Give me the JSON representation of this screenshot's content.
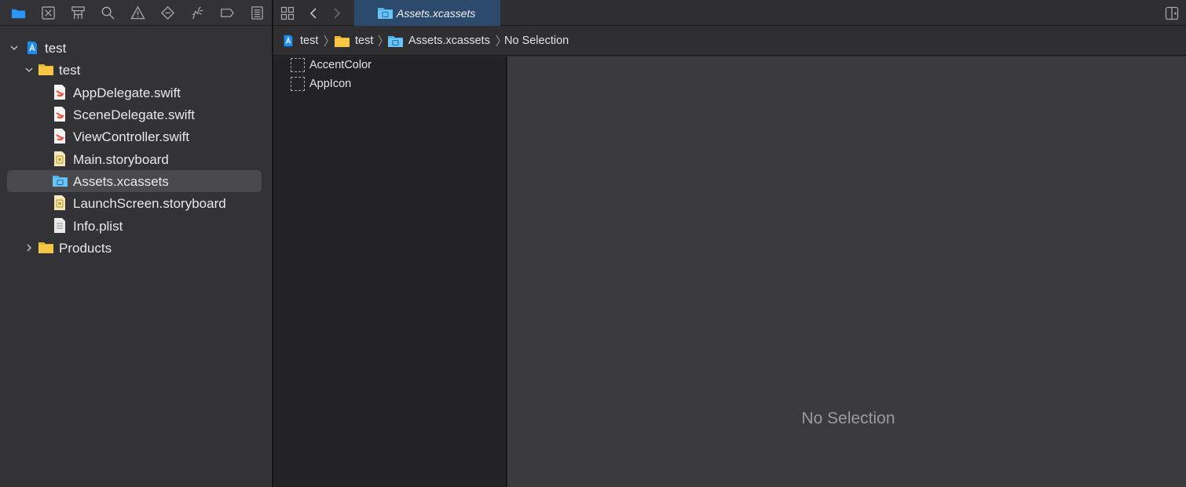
{
  "navigator": {
    "toolbar_icons": [
      "folder-icon",
      "source-control-icon",
      "symbol-icon",
      "find-icon",
      "issue-icon",
      "test-icon",
      "debug-icon",
      "breakpoint-icon",
      "report-icon"
    ],
    "tree": [
      {
        "label": "test",
        "icon": "project-icon",
        "expanded": true
      },
      {
        "label": "test",
        "icon": "folder-icon",
        "expanded": true
      },
      {
        "label": "AppDelegate.swift",
        "icon": "swift-file-icon"
      },
      {
        "label": "SceneDelegate.swift",
        "icon": "swift-file-icon"
      },
      {
        "label": "ViewController.swift",
        "icon": "swift-file-icon"
      },
      {
        "label": "Main.storyboard",
        "icon": "storyboard-icon"
      },
      {
        "label": "Assets.xcassets",
        "icon": "assets-folder-icon",
        "selected": true
      },
      {
        "label": "LaunchScreen.storyboard",
        "icon": "storyboard-icon"
      },
      {
        "label": "Info.plist",
        "icon": "plist-icon"
      },
      {
        "label": "Products",
        "icon": "folder-icon",
        "expanded": false
      }
    ]
  },
  "tabbar": {
    "active_tab": "Assets.xcassets"
  },
  "jumpbar": {
    "crumbs": [
      "test",
      "test",
      "Assets.xcassets",
      "No Selection"
    ]
  },
  "assets": {
    "items": [
      "AccentColor",
      "AppIcon"
    ]
  },
  "detail": {
    "empty_label": "No Selection"
  },
  "colors": {
    "accent": "#1d8cf2",
    "folder_yellow": "#f7c645",
    "swift_red": "#f05138",
    "selected_row": "#4a494e",
    "active_tab": "#2c4a6b"
  }
}
